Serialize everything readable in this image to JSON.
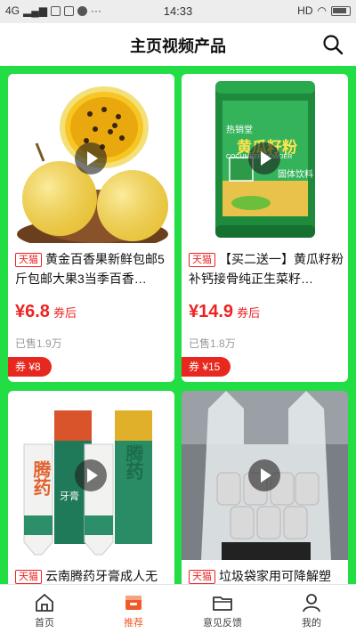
{
  "status_bar": {
    "left": "4G",
    "time": "14:33",
    "right": "HD"
  },
  "header": {
    "title": "主页视频产品"
  },
  "products": [
    {
      "badge": "天猫",
      "title": "黄金百香果新鲜包邮5斤包邮大果3当季百香…",
      "price": "¥6.8",
      "price_suffix": "券后",
      "sold": "已售1.9万",
      "coupon": "券 ¥8"
    },
    {
      "badge": "天猫",
      "title": "【买二送一】黄瓜籽粉补钙接骨纯正生菜籽…",
      "price": "¥14.9",
      "price_suffix": "券后",
      "sold": "已售1.8万",
      "coupon": "券 ¥15"
    },
    {
      "badge": "天猫",
      "title": "云南腾药牙膏成人无"
    },
    {
      "badge": "天猫",
      "title": "垃圾袋家用可降解塑"
    }
  ],
  "product_images": {
    "can_brand": "热销堂",
    "can_title": "黄瓜籽粉",
    "can_sub": "COCUMBER POWDER",
    "can_side": "固体饮料",
    "toothpaste_brand": "腾药",
    "toothpaste_type": "牙膏"
  },
  "tabs": [
    {
      "label": "首页",
      "icon": "home-icon",
      "active": false
    },
    {
      "label": "推荐",
      "icon": "recommend-icon",
      "active": true
    },
    {
      "label": "意见反馈",
      "icon": "folder-icon",
      "active": false
    },
    {
      "label": "我的",
      "icon": "profile-icon",
      "active": false
    }
  ],
  "colors": {
    "accent_green": "#22dd44",
    "price_red": "#e22222",
    "active_tab": "#f05a28"
  }
}
